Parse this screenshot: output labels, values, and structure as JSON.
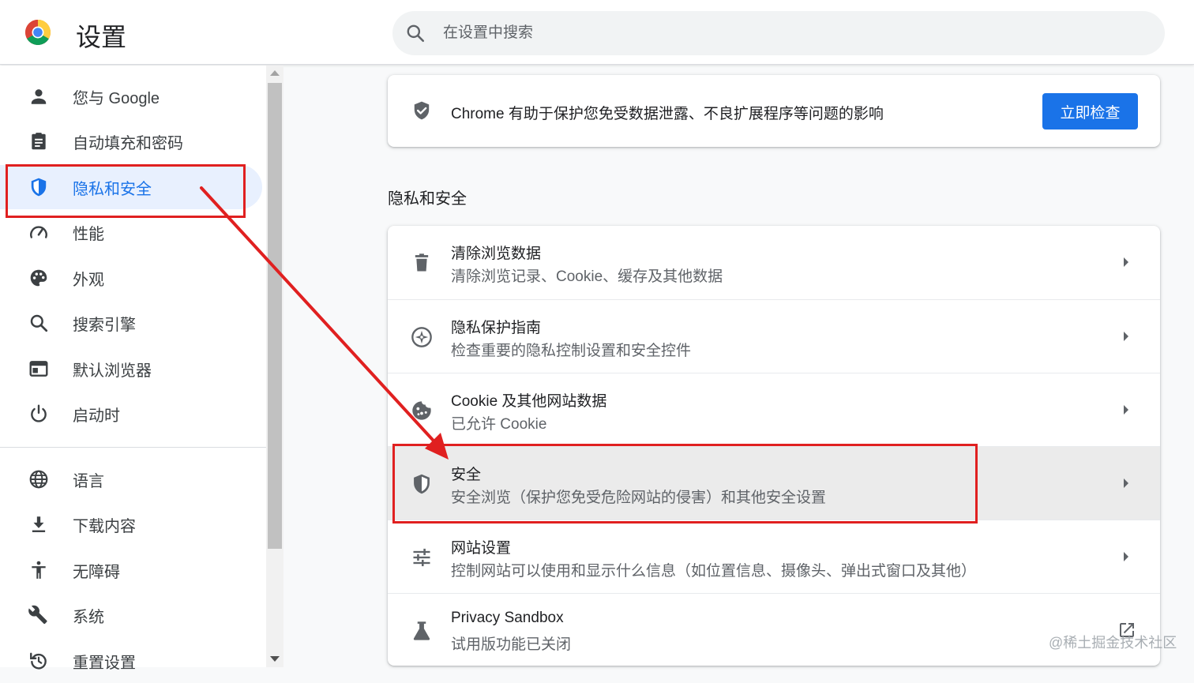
{
  "header": {
    "title": "设置",
    "search_placeholder": "在设置中搜索"
  },
  "sidebar": {
    "items": [
      {
        "label": "您与 Google",
        "icon": "person-icon"
      },
      {
        "label": "自动填充和密码",
        "icon": "clipboard-icon"
      },
      {
        "label": "隐私和安全",
        "icon": "shield-icon",
        "active": true
      },
      {
        "label": "性能",
        "icon": "speedometer-icon"
      },
      {
        "label": "外观",
        "icon": "palette-icon"
      },
      {
        "label": "搜索引擎",
        "icon": "search-icon"
      },
      {
        "label": "默认浏览器",
        "icon": "browser-icon"
      },
      {
        "label": "启动时",
        "icon": "power-icon"
      },
      {
        "label": "语言",
        "icon": "globe-icon"
      },
      {
        "label": "下载内容",
        "icon": "download-icon"
      },
      {
        "label": "无障碍",
        "icon": "accessibility-icon"
      },
      {
        "label": "系统",
        "icon": "wrench-icon"
      },
      {
        "label": "重置设置",
        "icon": "reset-icon"
      }
    ]
  },
  "safety_check": {
    "text": "Chrome 有助于保护您免受数据泄露、不良扩展程序等问题的影响",
    "button_label": "立即检查"
  },
  "main": {
    "section_title": "隐私和安全",
    "rows": [
      {
        "title": "清除浏览数据",
        "subtitle": "清除浏览记录、Cookie、缓存及其他数据",
        "icon": "trash-icon"
      },
      {
        "title": "隐私保护指南",
        "subtitle": "检查重要的隐私控制设置和安全控件",
        "icon": "compass-icon"
      },
      {
        "title": "Cookie 及其他网站数据",
        "subtitle": "已允许 Cookie",
        "icon": "cookie-icon"
      },
      {
        "title": "安全",
        "subtitle": "安全浏览（保护您免受危险网站的侵害）和其他安全设置",
        "icon": "shield-half-icon"
      },
      {
        "title": "网站设置",
        "subtitle": "控制网站可以使用和显示什么信息（如位置信息、摄像头、弹出式窗口及其他）",
        "icon": "tune-icon"
      },
      {
        "title": "Privacy Sandbox",
        "subtitle": "试用版功能已关闭",
        "icon": "flask-icon"
      }
    ]
  },
  "watermark": "@稀土掘金技术社区",
  "colors": {
    "accent": "#1a73e8",
    "active_bg": "#e8f0fe",
    "annotation_red": "#e02020"
  }
}
